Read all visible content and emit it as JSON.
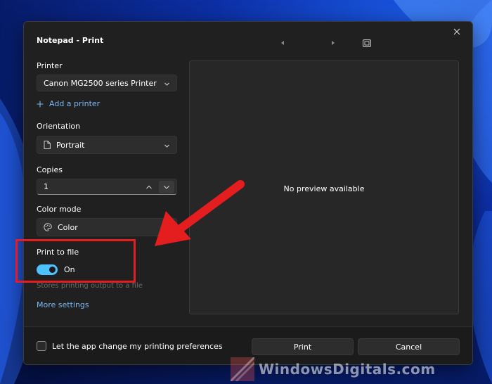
{
  "dialog": {
    "title": "Notepad - Print"
  },
  "printer": {
    "label": "Printer",
    "selected": "Canon MG2500 series Printer",
    "add_label": "Add a printer"
  },
  "orientation": {
    "label": "Orientation",
    "selected": "Portrait"
  },
  "copies": {
    "label": "Copies",
    "value": "1"
  },
  "color_mode": {
    "label": "Color mode",
    "selected": "Color"
  },
  "print_to_file": {
    "label": "Print to file",
    "state": "On",
    "on": true,
    "hint": "Stores printing output to a file"
  },
  "more_settings": "More settings",
  "preview": {
    "message": "No preview available"
  },
  "footer": {
    "checkbox_label": "Let the app change my printing preferences",
    "checked": false,
    "print_button": "Print",
    "cancel_button": "Cancel"
  },
  "colors": {
    "accent": "#4cc2ff",
    "link": "#7ab8f5",
    "annotation": "#e41e1e"
  },
  "watermark": "WindowsDigitals.com"
}
